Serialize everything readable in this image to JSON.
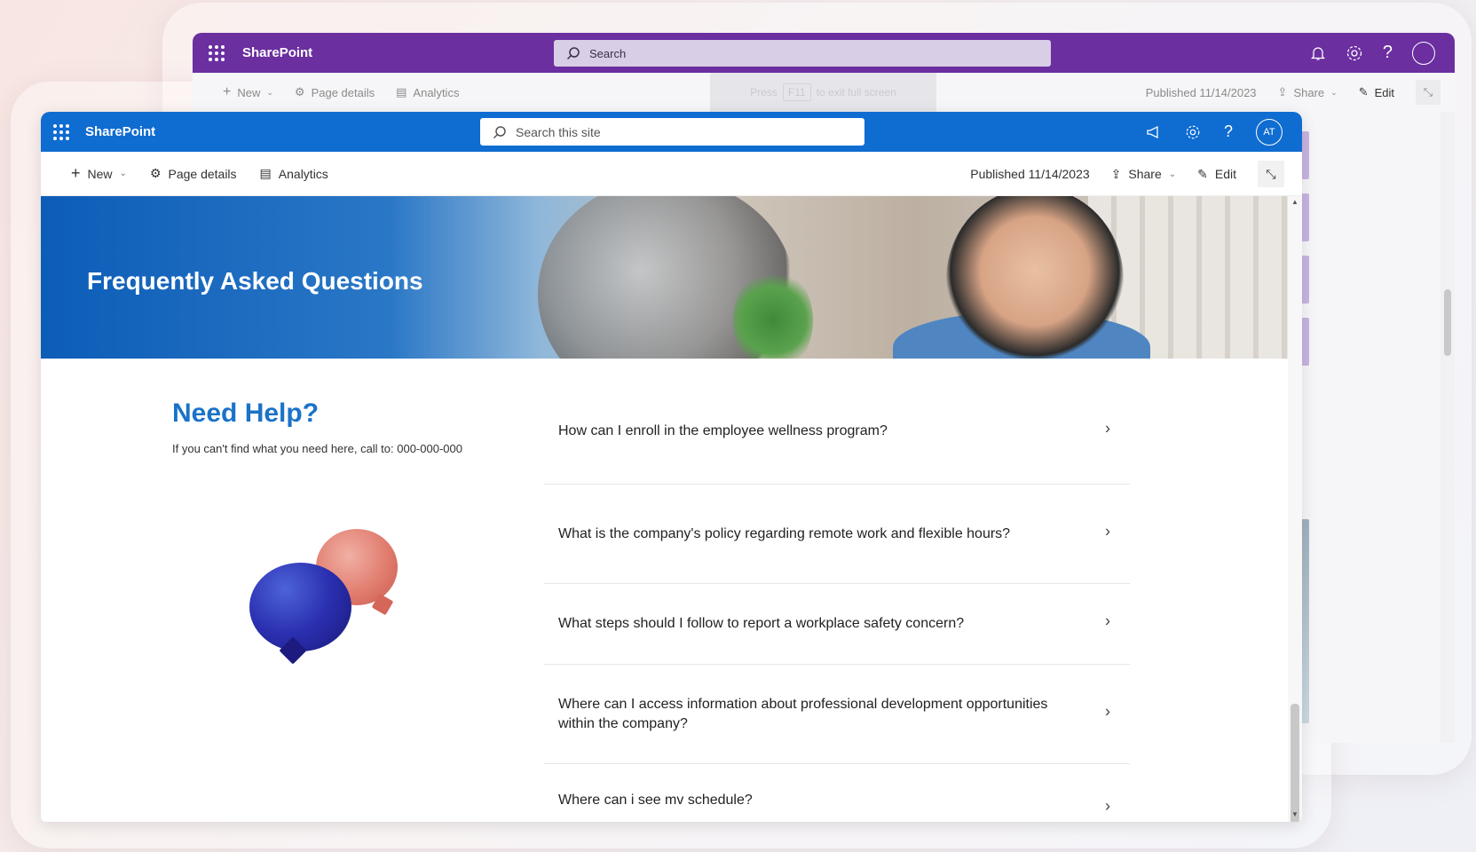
{
  "back_window": {
    "app_name": "SharePoint",
    "search_placeholder": "Search",
    "commands": {
      "new": "New",
      "page_details": "Page details",
      "analytics": "Analytics"
    },
    "fullscreen_hint": {
      "press": "Press",
      "key": "F11",
      "rest": "to exit full screen"
    },
    "published": "Published 11/14/2023",
    "share": "Share",
    "edit": "Edit",
    "accent_color": "#6b2fa0"
  },
  "front_window": {
    "app_name": "SharePoint",
    "search_placeholder": "Search this site",
    "avatar_initials": "AT",
    "commands": {
      "new": "New",
      "page_details": "Page details",
      "analytics": "Analytics"
    },
    "published": "Published 11/14/2023",
    "share": "Share",
    "edit": "Edit",
    "accent_color": "#0f6cd1"
  },
  "hero": {
    "title": "Frequently Asked Questions"
  },
  "help": {
    "title": "Need Help?",
    "text": "If you can't find what you need here, call to:  000-000-000"
  },
  "faq": [
    {
      "question": "How can I enroll in the employee wellness program?"
    },
    {
      "question": "What is the company's policy regarding remote work and flexible hours?"
    },
    {
      "question": "What steps should I follow to report a workplace safety concern?"
    },
    {
      "question": "Where can I access information about professional development opportunities within the company?"
    },
    {
      "question": "Where can i see mv schedule?"
    }
  ]
}
